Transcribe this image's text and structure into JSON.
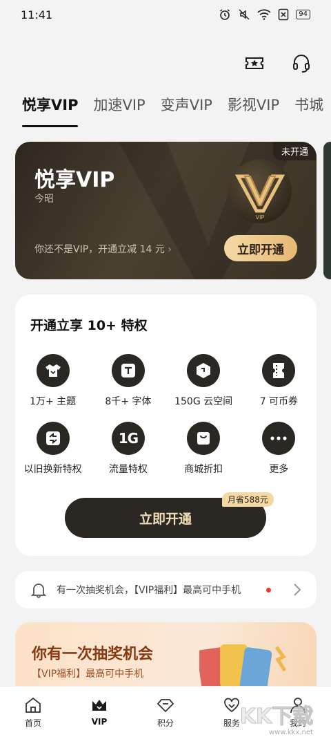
{
  "status": {
    "time": "11:41",
    "battery": "94"
  },
  "tabs": [
    {
      "label": "悦享VIP",
      "active": true
    },
    {
      "label": "加速VIP"
    },
    {
      "label": "变声VIP"
    },
    {
      "label": "影视VIP"
    },
    {
      "label": "书城"
    }
  ],
  "vip_card": {
    "badge": "未开通",
    "title": "悦享VIP",
    "user": "今昭",
    "tip": "你还不是VIP，开通立减 14 元",
    "button": "立即开通",
    "logo_text": "VIP"
  },
  "privileges": {
    "heading": "开通立享 10+ 特权",
    "items": [
      {
        "label": "1万+ 主题",
        "icon": "shirt-icon"
      },
      {
        "label": "8千+ 字体",
        "icon": "font-icon"
      },
      {
        "label": "150G 云空间",
        "icon": "cloud-box-icon"
      },
      {
        "label": "7 可币券",
        "icon": "ticket-icon"
      },
      {
        "label": "以旧换新特权",
        "icon": "exchange-icon"
      },
      {
        "label": "流量特权",
        "icon": "data-1g-icon"
      },
      {
        "label": "商城折扣",
        "icon": "bag-icon"
      },
      {
        "label": "更多",
        "icon": "more-icon"
      }
    ],
    "icon_glyph_1g": "1G",
    "button": "立即开通",
    "save_tag": "月省588元"
  },
  "notice": {
    "text": "有一次抽奖机会，【VIP福利】最高可中手机"
  },
  "lottery": {
    "title": "你有一次抽奖机会",
    "subtitle": "【VIP福利】最高可中手机"
  },
  "nav": [
    {
      "label": "首页",
      "icon": "home-icon"
    },
    {
      "label": "VIP",
      "icon": "crown-icon",
      "active": true
    },
    {
      "label": "积分",
      "icon": "diamond-icon"
    },
    {
      "label": "服务",
      "icon": "heart-service-icon"
    },
    {
      "label": "我的",
      "icon": "user-icon"
    }
  ],
  "watermark": {
    "text": "KK下载",
    "sub": "www.kkx.net"
  },
  "colors": {
    "card_dark": "#2e271f",
    "gold": "#e7b874",
    "accent_red": "#e3413a"
  }
}
